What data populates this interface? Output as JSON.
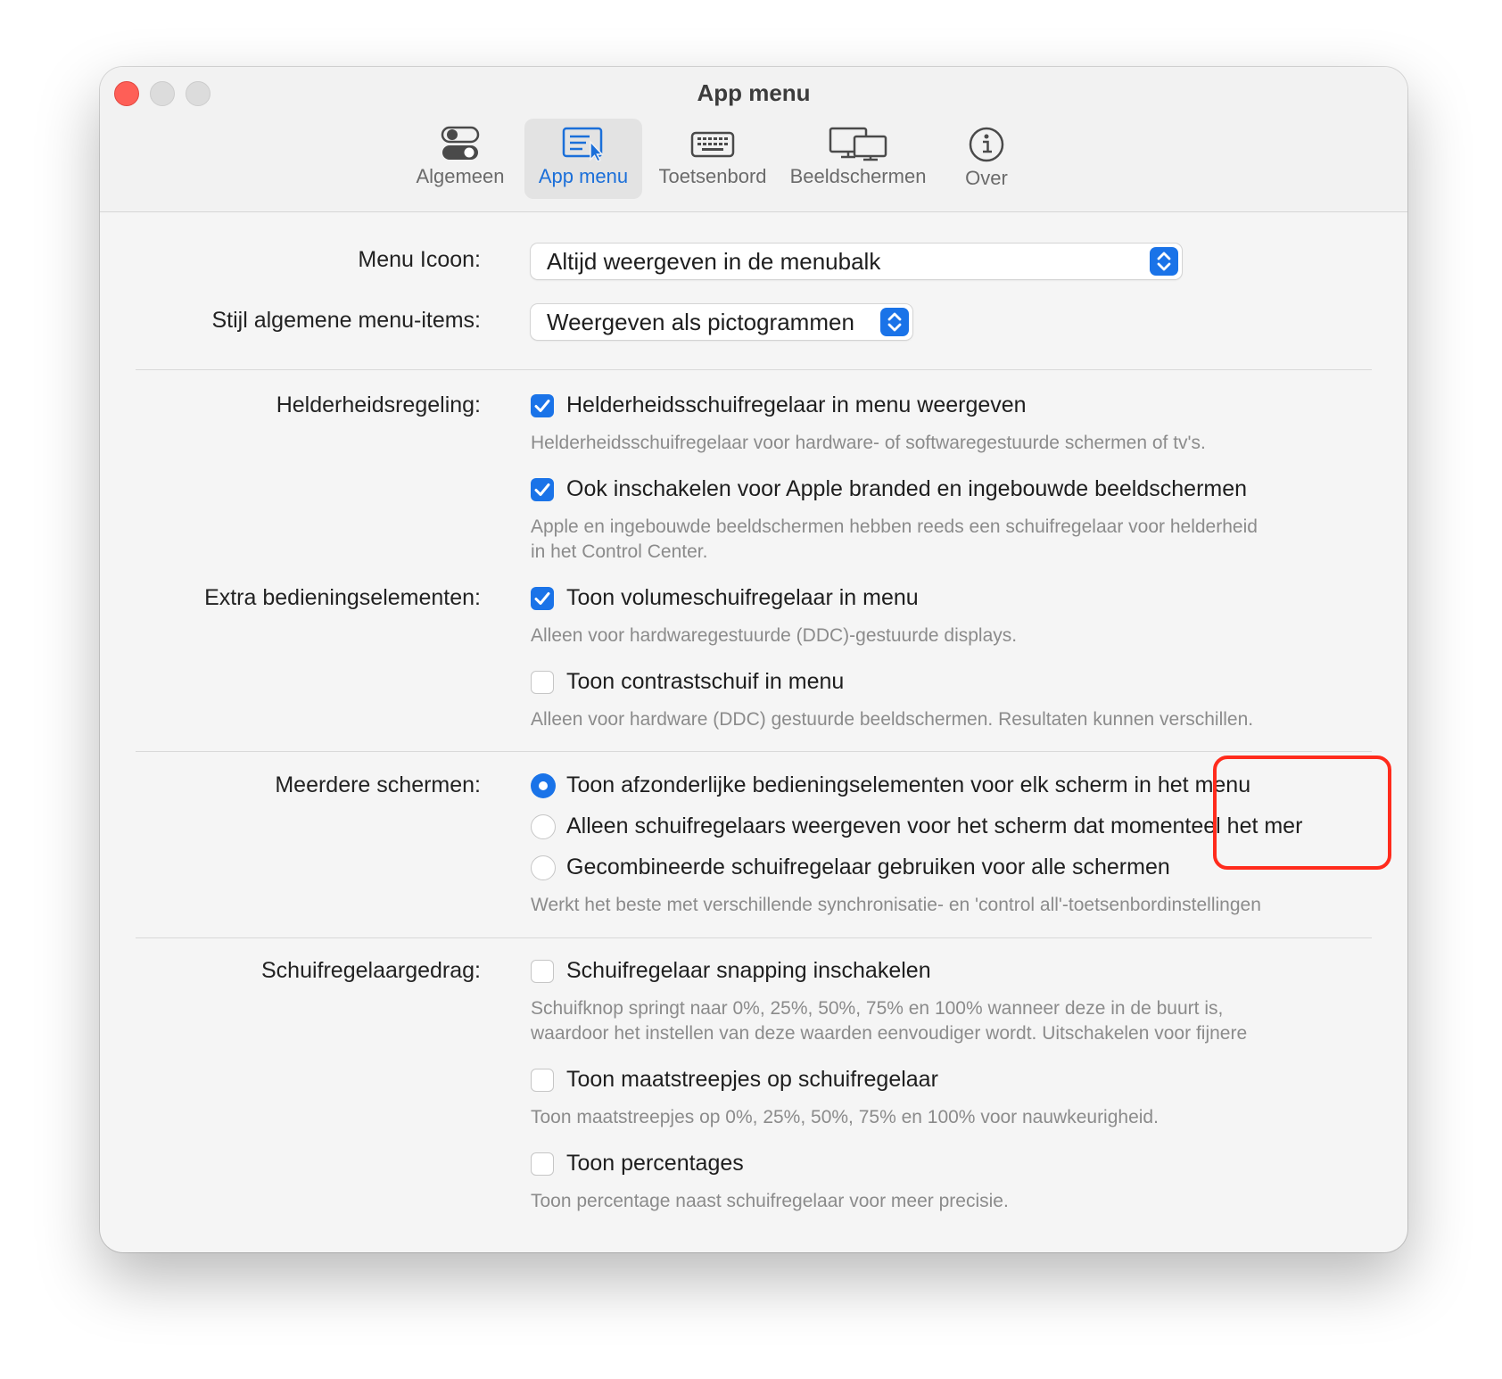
{
  "window": {
    "title": "App menu"
  },
  "tabs": [
    {
      "label": "Algemeen",
      "icon": "toggles-icon"
    },
    {
      "label": "App menu",
      "icon": "app-menu-icon",
      "active": true
    },
    {
      "label": "Toetsenbord",
      "icon": "keyboard-icon"
    },
    {
      "label": "Beeldschermen",
      "icon": "displays-icon"
    },
    {
      "label": "Over",
      "icon": "info-icon"
    }
  ],
  "menu_icon": {
    "label": "Menu Icoon:",
    "value": "Altijd weergeven in de menubalk"
  },
  "item_style": {
    "label": "Stijl algemene menu-items:",
    "value": "Weergeven als pictogrammen"
  },
  "brightness": {
    "label": "Helderheidsregeling:",
    "slider": {
      "text": "Helderheidsschuifregelaar in menu weergeven",
      "checked": true,
      "help": "Helderheidsschuifregelaar voor hardware- of softwaregestuurde schermen of tv's."
    },
    "apple": {
      "text": "Ook inschakelen voor Apple branded en ingebouwde beeldschermen",
      "checked": true,
      "help_line1": "Apple en ingebouwde beeldschermen hebben reeds een schuifregelaar voor helderheid",
      "help_line2": "in het Control Center."
    }
  },
  "extra": {
    "label": "Extra bedieningselementen:",
    "volume": {
      "text": "Toon volumeschuifregelaar in menu",
      "checked": true,
      "help": "Alleen voor hardwaregestuurde (DDC)-gestuurde displays."
    },
    "contrast": {
      "text": "Toon contrastschuif in menu",
      "checked": false,
      "help": "Alleen voor hardware (DDC) gestuurde beeldschermen. Resultaten kunnen verschillen."
    }
  },
  "multi": {
    "label": "Meerdere schermen:",
    "options": [
      {
        "text": "Toon afzonderlijke bedieningselementen voor elk scherm in het menu",
        "selected": true
      },
      {
        "text": "Alleen schuifregelaars weergeven voor het scherm dat momenteel het mer",
        "selected": false
      },
      {
        "text": "Gecombineerde schuifregelaar gebruiken voor alle schermen",
        "selected": false
      }
    ],
    "help": "Werkt het beste met verschillende synchronisatie- en 'control all'-toetsenbordinstellingen"
  },
  "slider_behavior": {
    "label": "Schuifregelaargedrag:",
    "snapping": {
      "text": "Schuifregelaar snapping inschakelen",
      "checked": false,
      "help_line1": "Schuifknop springt naar 0%, 25%, 50%, 75% en 100% wanneer deze in de buurt is,",
      "help_line2": "waardoor het instellen van deze waarden eenvoudiger wordt. Uitschakelen voor fijnere"
    },
    "ticks": {
      "text": "Toon maatstreepjes op schuifregelaar",
      "checked": false,
      "help": "Toon maatstreepjes op 0%, 25%, 50%, 75% en 100% voor nauwkeurigheid."
    },
    "percentages": {
      "text": "Toon percentages",
      "checked": false,
      "help": "Toon percentage naast schuifregelaar voor meer precisie."
    }
  },
  "colors": {
    "accent": "#1a73e8",
    "annotation": "#ff2b1c",
    "close": "#fe5f57"
  }
}
